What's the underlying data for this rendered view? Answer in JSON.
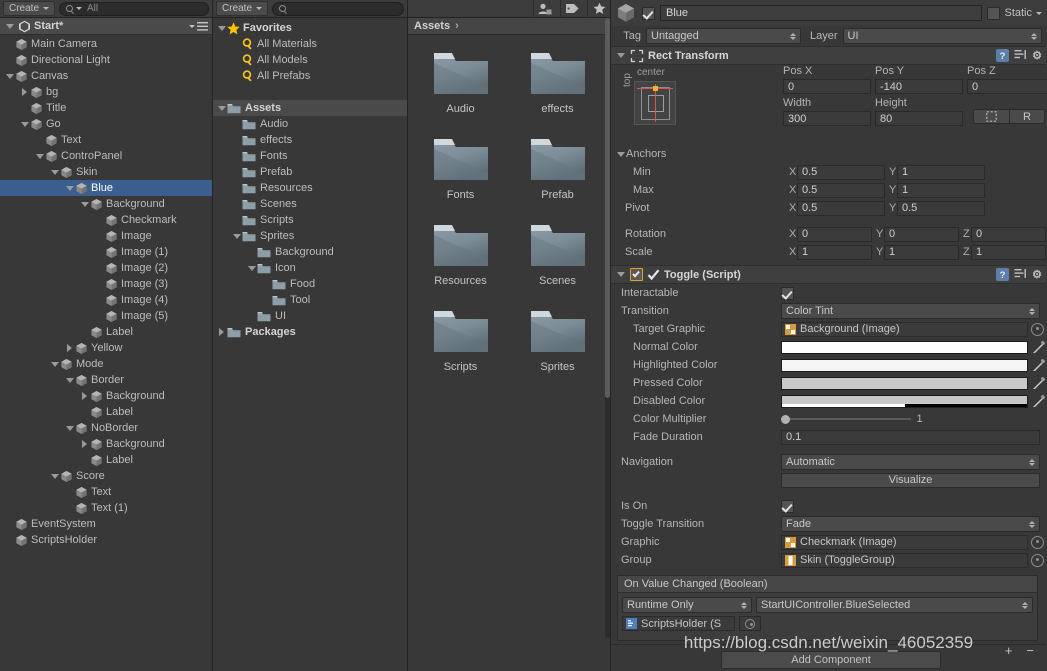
{
  "hierarchy": {
    "toolbar": {
      "create_label": "Create",
      "search_value": "All",
      "search_icon": "search-icon"
    },
    "scene": {
      "name": "Start*",
      "unity_icon": "unity-logo-icon",
      "menu_icon": "panel-menu-icon"
    },
    "items": [
      {
        "label": "Main Camera",
        "depth": 1,
        "toggle": "none",
        "selected": false
      },
      {
        "label": "Directional Light",
        "depth": 1,
        "toggle": "none",
        "selected": false
      },
      {
        "label": "Canvas",
        "depth": 1,
        "toggle": "expanded",
        "selected": false
      },
      {
        "label": "bg",
        "depth": 2,
        "toggle": "collapsed",
        "selected": false
      },
      {
        "label": "Title",
        "depth": 2,
        "toggle": "none",
        "selected": false
      },
      {
        "label": "Go",
        "depth": 2,
        "toggle": "expanded",
        "selected": false
      },
      {
        "label": "Text",
        "depth": 3,
        "toggle": "none",
        "selected": false
      },
      {
        "label": "ControPanel",
        "depth": 3,
        "toggle": "expanded",
        "selected": false
      },
      {
        "label": "Skin",
        "depth": 4,
        "toggle": "expanded",
        "selected": false
      },
      {
        "label": "Blue",
        "depth": 5,
        "toggle": "expanded",
        "selected": true
      },
      {
        "label": "Background",
        "depth": 6,
        "toggle": "expanded",
        "selected": false
      },
      {
        "label": "Checkmark",
        "depth": 7,
        "toggle": "none",
        "selected": false
      },
      {
        "label": "Image",
        "depth": 7,
        "toggle": "none",
        "selected": false
      },
      {
        "label": "Image (1)",
        "depth": 7,
        "toggle": "none",
        "selected": false
      },
      {
        "label": "Image (2)",
        "depth": 7,
        "toggle": "none",
        "selected": false
      },
      {
        "label": "Image (3)",
        "depth": 7,
        "toggle": "none",
        "selected": false
      },
      {
        "label": "Image (4)",
        "depth": 7,
        "toggle": "none",
        "selected": false
      },
      {
        "label": "Image (5)",
        "depth": 7,
        "toggle": "none",
        "selected": false
      },
      {
        "label": "Label",
        "depth": 6,
        "toggle": "none",
        "selected": false
      },
      {
        "label": "Yellow",
        "depth": 5,
        "toggle": "collapsed",
        "selected": false
      },
      {
        "label": "Mode",
        "depth": 4,
        "toggle": "expanded",
        "selected": false
      },
      {
        "label": "Border",
        "depth": 5,
        "toggle": "expanded",
        "selected": false
      },
      {
        "label": "Background",
        "depth": 6,
        "toggle": "collapsed",
        "selected": false
      },
      {
        "label": "Label",
        "depth": 6,
        "toggle": "none",
        "selected": false
      },
      {
        "label": "NoBorder",
        "depth": 5,
        "toggle": "expanded",
        "selected": false
      },
      {
        "label": "Background",
        "depth": 6,
        "toggle": "collapsed",
        "selected": false
      },
      {
        "label": "Label",
        "depth": 6,
        "toggle": "none",
        "selected": false
      },
      {
        "label": "Score",
        "depth": 4,
        "toggle": "expanded",
        "selected": false
      },
      {
        "label": "Text",
        "depth": 5,
        "toggle": "none",
        "selected": false
      },
      {
        "label": "Text (1)",
        "depth": 5,
        "toggle": "none",
        "selected": false
      },
      {
        "label": "EventSystem",
        "depth": 1,
        "toggle": "none",
        "selected": false
      },
      {
        "label": "ScriptsHolder",
        "depth": 1,
        "toggle": "none",
        "selected": false
      }
    ]
  },
  "project": {
    "toolbar": {
      "create_label": "Create",
      "search_value": "",
      "search_icon": "search-icon"
    },
    "items": [
      {
        "label": "Favorites",
        "depth": 0,
        "toggle": "expanded",
        "icon": "star-icon",
        "bold": true,
        "highlight": false
      },
      {
        "label": "All Materials",
        "depth": 1,
        "toggle": "none",
        "icon": "search-lens-icon",
        "bold": false,
        "highlight": false
      },
      {
        "label": "All Models",
        "depth": 1,
        "toggle": "none",
        "icon": "search-lens-icon",
        "bold": false,
        "highlight": false
      },
      {
        "label": "All Prefabs",
        "depth": 1,
        "toggle": "none",
        "icon": "search-lens-icon",
        "bold": false,
        "highlight": false
      },
      {
        "label": "",
        "depth": 0,
        "toggle": "none",
        "icon": "spacer",
        "bold": false,
        "highlight": false
      },
      {
        "label": "Assets",
        "depth": 0,
        "toggle": "expanded",
        "icon": "folder-icon",
        "bold": true,
        "highlight": true
      },
      {
        "label": "Audio",
        "depth": 1,
        "toggle": "none",
        "icon": "folder-icon",
        "bold": false,
        "highlight": false
      },
      {
        "label": "effects",
        "depth": 1,
        "toggle": "none",
        "icon": "folder-icon",
        "bold": false,
        "highlight": false
      },
      {
        "label": "Fonts",
        "depth": 1,
        "toggle": "none",
        "icon": "folder-icon",
        "bold": false,
        "highlight": false
      },
      {
        "label": "Prefab",
        "depth": 1,
        "toggle": "none",
        "icon": "folder-icon",
        "bold": false,
        "highlight": false
      },
      {
        "label": "Resources",
        "depth": 1,
        "toggle": "none",
        "icon": "folder-icon",
        "bold": false,
        "highlight": false
      },
      {
        "label": "Scenes",
        "depth": 1,
        "toggle": "none",
        "icon": "folder-icon",
        "bold": false,
        "highlight": false
      },
      {
        "label": "Scripts",
        "depth": 1,
        "toggle": "none",
        "icon": "folder-icon",
        "bold": false,
        "highlight": false
      },
      {
        "label": "Sprites",
        "depth": 1,
        "toggle": "expanded",
        "icon": "folder-icon",
        "bold": false,
        "highlight": false
      },
      {
        "label": "Background",
        "depth": 2,
        "toggle": "none",
        "icon": "folder-icon",
        "bold": false,
        "highlight": false
      },
      {
        "label": "Icon",
        "depth": 2,
        "toggle": "expanded",
        "icon": "folder-icon",
        "bold": false,
        "highlight": false
      },
      {
        "label": "Food",
        "depth": 3,
        "toggle": "none",
        "icon": "folder-icon",
        "bold": false,
        "highlight": false
      },
      {
        "label": "Tool",
        "depth": 3,
        "toggle": "none",
        "icon": "folder-icon",
        "bold": false,
        "highlight": false
      },
      {
        "label": "UI",
        "depth": 2,
        "toggle": "none",
        "icon": "folder-icon",
        "bold": false,
        "highlight": false
      },
      {
        "label": "Packages",
        "depth": 0,
        "toggle": "collapsed",
        "icon": "folder-icon",
        "bold": true,
        "highlight": false
      }
    ]
  },
  "assets": {
    "toolbar_icons": [
      "person-tag-icon",
      "label-tag-icon",
      "star-icon"
    ],
    "breadcrumb": "Assets",
    "breadcrumb_chevron": "›",
    "folders": [
      {
        "name": "Audio"
      },
      {
        "name": "effects"
      },
      {
        "name": "Fonts"
      },
      {
        "name": "Prefab"
      },
      {
        "name": "Resources"
      },
      {
        "name": "Scenes"
      },
      {
        "name": "Scripts"
      },
      {
        "name": "Sprites"
      }
    ]
  },
  "inspector": {
    "header": {
      "object_icon": "gameobject-cube-icon",
      "enabled": true,
      "name": "Blue",
      "static_label": "Static",
      "static_checked": false,
      "static_dropdown_icon": "chevron-down-icon"
    },
    "tag_row": {
      "tag_label": "Tag",
      "tag_value": "Untagged",
      "layer_label": "Layer",
      "layer_value": "UI"
    },
    "rect_transform": {
      "title": "Rect Transform",
      "help_icon": "help-icon",
      "preset_icon": "preset-icon",
      "gear_icon": "gear-icon",
      "anchor_preset_top": "center",
      "anchor_preset_side": "top",
      "pos_labels": [
        "Pos X",
        "Pos Y",
        "Pos Z"
      ],
      "pos_values": [
        "0",
        "-140",
        "0"
      ],
      "size_labels": [
        "Width",
        "Height"
      ],
      "size_values": [
        "300",
        "80"
      ],
      "blueprint_icon": "blueprint-icon",
      "raw_label": "R",
      "anchors_label": "Anchors",
      "min_label": "Min",
      "min_x": "0.5",
      "min_y": "1",
      "max_label": "Max",
      "max_x": "0.5",
      "max_y": "1",
      "pivot_label": "Pivot",
      "pivot_x": "0.5",
      "pivot_y": "0.5",
      "rotation_label": "Rotation",
      "rotation": [
        "0",
        "0",
        "0"
      ],
      "scale_label": "Scale",
      "scale": [
        "1",
        "1",
        "1"
      ]
    },
    "toggle_script": {
      "title": "Toggle (Script)",
      "component_enabled": true,
      "script_icon": "script-checkmark-icon",
      "help_icon": "help-icon",
      "preset_icon": "preset-icon",
      "gear_icon": "gear-icon",
      "interactable_label": "Interactable",
      "interactable_checked": true,
      "transition_label": "Transition",
      "transition_value": "Color Tint",
      "target_graphic_label": "Target Graphic",
      "target_graphic_value": "Background (Image)",
      "target_graphic_icon": "image-component-icon",
      "normal_color_label": "Normal Color",
      "normal_color_hex": "#FFFFFF",
      "highlighted_color_label": "Highlighted Color",
      "highlighted_color_hex": "#F5F5F5",
      "pressed_color_label": "Pressed Color",
      "pressed_color_hex": "#C8C8C8",
      "disabled_color_label": "Disabled Color",
      "disabled_color_hex": "#C8C8C8",
      "disabled_alpha_pct": 50,
      "color_multiplier_label": "Color Multiplier",
      "color_multiplier_value": "1",
      "color_multiplier_pct": 0,
      "fade_duration_label": "Fade Duration",
      "fade_duration_value": "0.1",
      "navigation_label": "Navigation",
      "navigation_value": "Automatic",
      "visualize_label": "Visualize",
      "is_on_label": "Is On",
      "is_on_checked": true,
      "toggle_transition_label": "Toggle Transition",
      "toggle_transition_value": "Fade",
      "graphic_label": "Graphic",
      "graphic_value": "Checkmark (Image)",
      "graphic_icon": "image-component-icon",
      "group_label": "Group",
      "group_value": "Skin (ToggleGroup)",
      "group_icon": "togglegroup-component-icon"
    },
    "event": {
      "title": "On Value Changed (Boolean)",
      "mode_value": "Runtime Only",
      "function_value": "StartUIController.BlueSelected",
      "object_value": "ScriptsHolder (S",
      "object_icon": "script-component-icon",
      "picker_icon": "object-picker-icon",
      "add_label": "+",
      "remove_label": "−"
    },
    "add_component_label": "Add Component"
  },
  "watermark": "https://blog.csdn.net/weixin_46052359",
  "colors": {
    "selection_blue": "#3A5F8F",
    "panel_bg": "#383838",
    "toolbar_bg": "#3C3C3C",
    "field_bg": "#3B3B3B",
    "star_yellow": "#FFC400"
  }
}
